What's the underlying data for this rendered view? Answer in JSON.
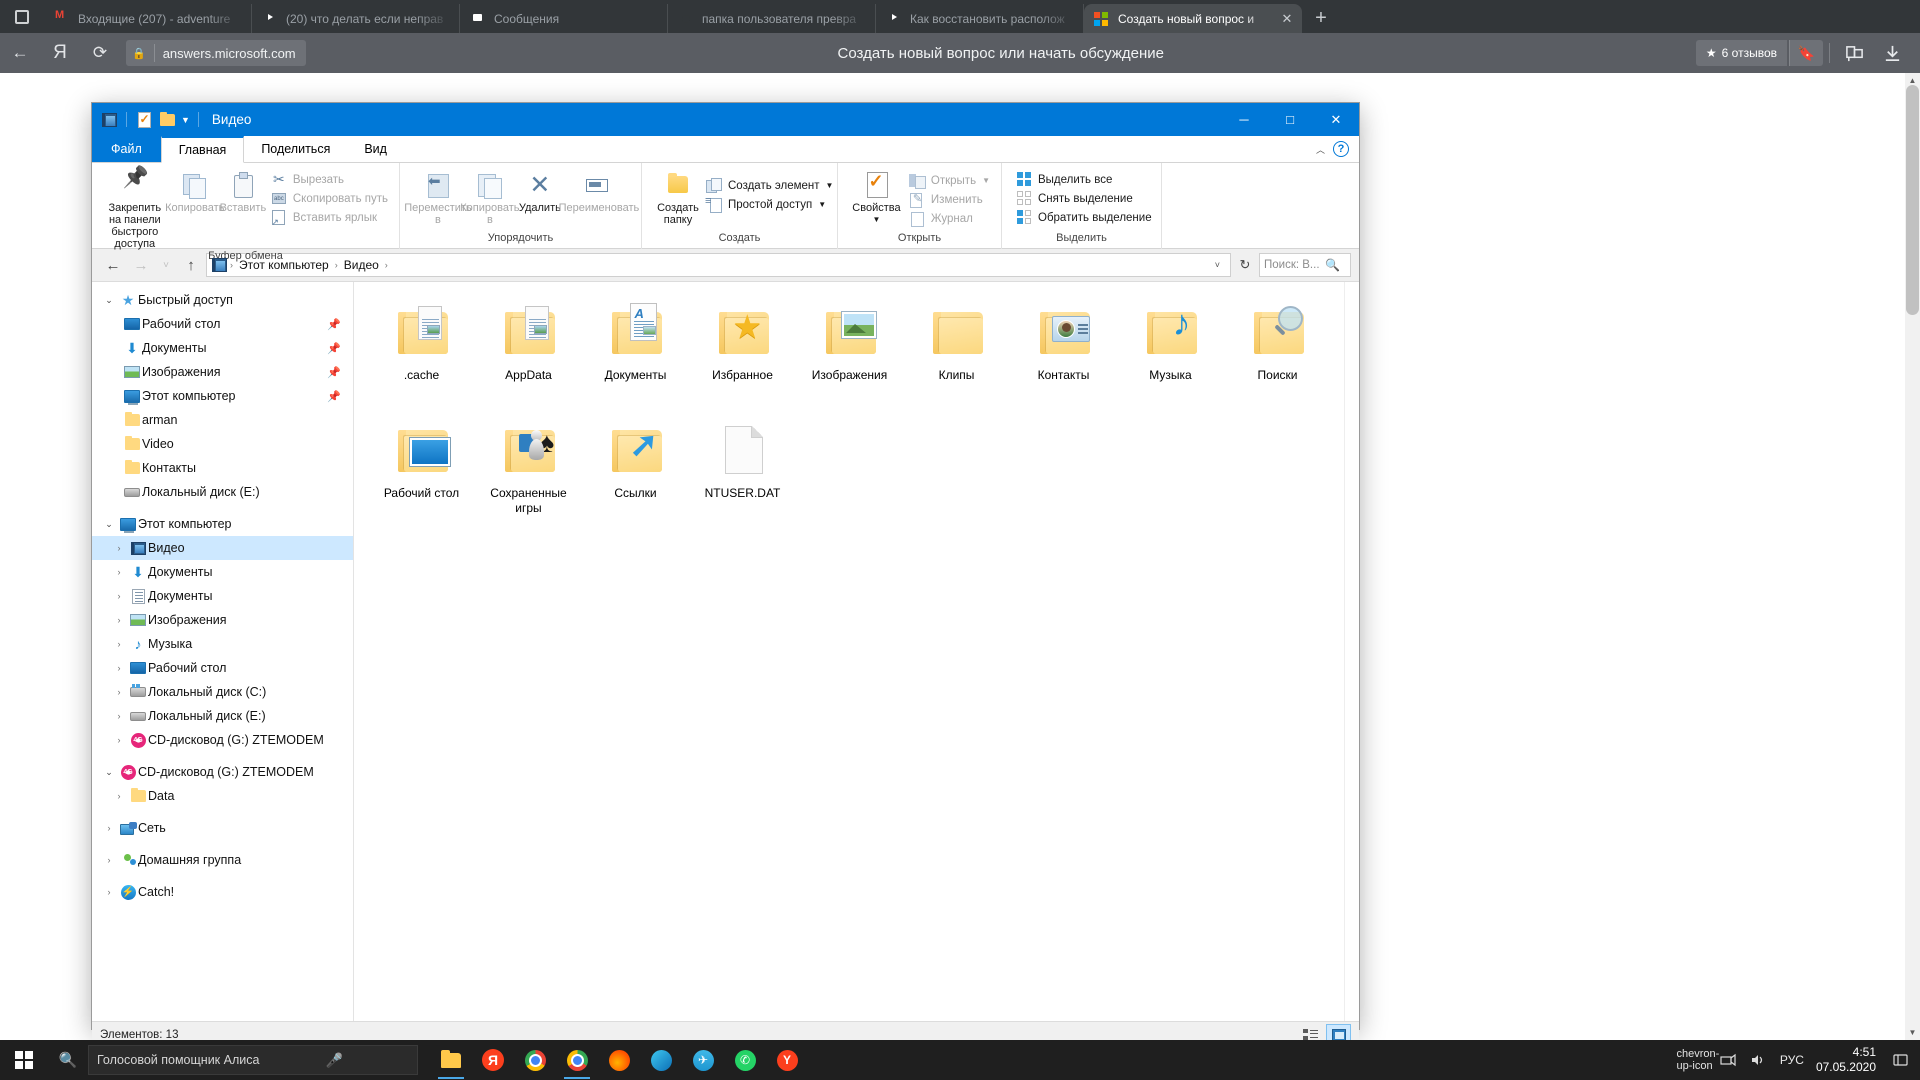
{
  "browser": {
    "tabs": [
      {
        "title": "Входящие (207) - adventure",
        "favicon": "gmail-icon",
        "active": false
      },
      {
        "title": "(20) что делать если неправ",
        "favicon": "youtube-icon",
        "active": false
      },
      {
        "title": "Сообщения",
        "favicon": "messages-icon",
        "active": false
      },
      {
        "title": "папка пользователя превра",
        "favicon": "google-icon",
        "active": false
      },
      {
        "title": "Как восстановить располож",
        "favicon": "youtube-icon",
        "active": false
      },
      {
        "title": "Создать новый вопрос и",
        "favicon": "microsoft-icon",
        "active": true
      }
    ],
    "new_tab_label": "+",
    "tab_close_label": "✕",
    "back_label": "←",
    "brand_label": "Я",
    "reload_label": "⟳",
    "url": "answers.microsoft.com",
    "lock_icon": "lock-icon",
    "page_title": "Создать новый вопрос или начать обсуждение",
    "reviews_label": "6 отзывов",
    "reviews_star": "★",
    "bookmark_icon": "bookmark-icon",
    "collections_icon": "collections-icon",
    "download_icon": "download-icon"
  },
  "explorer": {
    "title": "Видео",
    "quick_access_icons": [
      "video-library-icon",
      "properties-icon",
      "new-folder-icon",
      "dropdown-caret-icon"
    ],
    "window_controls": {
      "minimize": "─",
      "maximize": "□",
      "close": "✕"
    },
    "ribbon_tabs": [
      {
        "label": "Файл",
        "type": "file"
      },
      {
        "label": "Главная",
        "type": "selected"
      },
      {
        "label": "Поделиться",
        "type": "normal"
      },
      {
        "label": "Вид",
        "type": "normal"
      }
    ],
    "ribbon_collapse_icon": "chevron-up-icon",
    "help_icon": "?",
    "ribbon_groups": [
      {
        "label": "Буфер обмена",
        "big_buttons": [
          {
            "label": "Закрепить на панели быстрого доступа",
            "icon": "pin-icon",
            "dim": false
          },
          {
            "label": "Копировать",
            "icon": "copy-icon",
            "dim": true
          },
          {
            "label": "Вставить",
            "icon": "paste-icon",
            "dim": true
          }
        ],
        "small_buttons": [
          {
            "label": "Вырезать",
            "icon": "scissors-icon",
            "dim": true
          },
          {
            "label": "Скопировать путь",
            "icon": "copy-path-icon",
            "dim": true
          },
          {
            "label": "Вставить ярлык",
            "icon": "paste-shortcut-icon",
            "dim": true
          }
        ]
      },
      {
        "label": "Упорядочить",
        "big_buttons": [
          {
            "label": "Переместить в",
            "icon": "move-to-icon",
            "dim": true,
            "caret": true
          },
          {
            "label": "Копировать в",
            "icon": "copy-to-icon",
            "dim": true,
            "caret": true
          },
          {
            "label": "Удалить",
            "icon": "delete-icon",
            "dim": false,
            "caret": false
          },
          {
            "label": "Переименовать",
            "icon": "rename-icon",
            "dim": true,
            "caret": false
          }
        ],
        "small_buttons": []
      },
      {
        "label": "Создать",
        "big_buttons": [
          {
            "label": "Создать папку",
            "icon": "new-folder-icon",
            "dim": false
          }
        ],
        "small_buttons": [
          {
            "label": "Создать элемент",
            "icon": "new-item-icon",
            "dim": false,
            "caret": true
          },
          {
            "label": "Простой доступ",
            "icon": "easy-access-icon",
            "dim": false,
            "caret": true
          }
        ]
      },
      {
        "label": "Открыть",
        "big_buttons": [
          {
            "label": "Свойства",
            "icon": "properties-icon",
            "dim": false,
            "caret": true
          }
        ],
        "small_buttons": [
          {
            "label": "Открыть",
            "icon": "open-icon",
            "dim": true,
            "caret": true
          },
          {
            "label": "Изменить",
            "icon": "edit-icon",
            "dim": true,
            "caret": false
          },
          {
            "label": "Журнал",
            "icon": "history-icon",
            "dim": true,
            "caret": false
          }
        ]
      },
      {
        "label": "Выделить",
        "big_buttons": [],
        "small_buttons": [
          {
            "label": "Выделить все",
            "icon": "select-all-icon",
            "dim": false,
            "caret": false
          },
          {
            "label": "Снять выделение",
            "icon": "select-none-icon",
            "dim": false,
            "caret": false
          },
          {
            "label": "Обратить выделение",
            "icon": "invert-selection-icon",
            "dim": false,
            "caret": false
          }
        ]
      }
    ],
    "nav": {
      "back": "←",
      "forward": "→",
      "recent": "˅",
      "up": "↑",
      "refresh": "↻",
      "breadcrumb_icon": "video-library-icon",
      "breadcrumbs": [
        "Этот компьютер",
        "Видео"
      ],
      "separator": "›",
      "dropdown_caret": "˅",
      "search_placeholder": "Поиск: В...",
      "search_icon": "search-icon"
    },
    "tree": [
      {
        "label": "Быстрый доступ",
        "icon": "quick-access-star-icon",
        "indent": 0,
        "chevron": "open",
        "pinned": false
      },
      {
        "label": "Рабочий стол",
        "icon": "desktop-icon",
        "indent": 1,
        "chevron": "none",
        "pinned": true
      },
      {
        "label": "Документы",
        "icon": "downloads-icon",
        "indent": 1,
        "chevron": "none",
        "pinned": true
      },
      {
        "label": "Изображения",
        "icon": "pictures-icon",
        "indent": 1,
        "chevron": "none",
        "pinned": true
      },
      {
        "label": "Этот компьютер",
        "icon": "this-pc-icon",
        "indent": 1,
        "chevron": "none",
        "pinned": true
      },
      {
        "label": "arman",
        "icon": "folder-icon",
        "indent": 1,
        "chevron": "none",
        "pinned": false
      },
      {
        "label": "Video",
        "icon": "folder-icon",
        "indent": 1,
        "chevron": "none",
        "pinned": false
      },
      {
        "label": "Контакты",
        "icon": "folder-icon",
        "indent": 1,
        "chevron": "none",
        "pinned": false
      },
      {
        "label": "Локальный диск (E:)",
        "icon": "disk-icon",
        "indent": 1,
        "chevron": "none",
        "pinned": false
      },
      {
        "label": "Этот компьютер",
        "icon": "this-pc-icon",
        "indent": 0,
        "chevron": "open",
        "pinned": false
      },
      {
        "label": "Видео",
        "icon": "video-library-icon",
        "indent": 1,
        "chevron": "closed",
        "pinned": false,
        "selected": true
      },
      {
        "label": "Документы",
        "icon": "downloads-icon",
        "indent": 1,
        "chevron": "closed",
        "pinned": false
      },
      {
        "label": "Документы",
        "icon": "documents-icon",
        "indent": 1,
        "chevron": "closed",
        "pinned": false
      },
      {
        "label": "Изображения",
        "icon": "pictures-icon",
        "indent": 1,
        "chevron": "closed",
        "pinned": false
      },
      {
        "label": "Музыка",
        "icon": "music-icon",
        "indent": 1,
        "chevron": "closed",
        "pinned": false
      },
      {
        "label": "Рабочий стол",
        "icon": "desktop-icon",
        "indent": 1,
        "chevron": "closed",
        "pinned": false
      },
      {
        "label": "Локальный диск (C:)",
        "icon": "system-disk-icon",
        "indent": 1,
        "chevron": "closed",
        "pinned": false
      },
      {
        "label": "Локальный диск (E:)",
        "icon": "disk-icon",
        "indent": 1,
        "chevron": "closed",
        "pinned": false
      },
      {
        "label": "CD-дисковод (G:) ZTEMODEM",
        "icon": "cd-drive-icon",
        "indent": 1,
        "chevron": "closed",
        "pinned": false
      },
      {
        "label": "CD-дисковод (G:) ZTEMODEM",
        "icon": "cd-drive-icon",
        "indent": 0,
        "chevron": "open",
        "pinned": false
      },
      {
        "label": "Data",
        "icon": "folder-icon",
        "indent": 1,
        "chevron": "closed",
        "pinned": false
      },
      {
        "label": "Сеть",
        "icon": "network-icon",
        "indent": 0,
        "chevron": "closed",
        "pinned": false
      },
      {
        "label": "Домашняя группа",
        "icon": "homegroup-icon",
        "indent": 0,
        "chevron": "closed",
        "pinned": false
      },
      {
        "label": "Catch!",
        "icon": "catch-icon",
        "indent": 0,
        "chevron": "closed",
        "pinned": false
      }
    ],
    "files": [
      {
        "name": ".cache",
        "icon": "folder-with-papers-icon"
      },
      {
        "name": "AppData",
        "icon": "folder-with-papers-icon"
      },
      {
        "name": "Документы",
        "icon": "documents-folder-icon"
      },
      {
        "name": "Избранное",
        "icon": "favorites-folder-icon"
      },
      {
        "name": "Изображения",
        "icon": "pictures-folder-icon"
      },
      {
        "name": "Клипы",
        "icon": "plain-folder-icon"
      },
      {
        "name": "Контакты",
        "icon": "contacts-folder-icon"
      },
      {
        "name": "Музыка",
        "icon": "music-folder-icon"
      },
      {
        "name": "Поиски",
        "icon": "searches-folder-icon"
      },
      {
        "name": "Рабочий стол",
        "icon": "desktop-folder-icon"
      },
      {
        "name": "Сохраненные игры",
        "icon": "saved-games-folder-icon"
      },
      {
        "name": "Ссылки",
        "icon": "links-folder-icon"
      },
      {
        "name": "NTUSER.DAT",
        "icon": "generic-file-icon"
      }
    ],
    "status": {
      "items_count": "Элементов: 13",
      "view_details_icon": "details-view-icon",
      "view_tiles_icon": "tiles-view-icon"
    }
  },
  "taskbar": {
    "start_icon": "windows-start-icon",
    "search_icon": "search-icon",
    "search_value": "Голосовой помощник Алиса",
    "mic_icon": "microphone-icon",
    "apps": [
      {
        "icon": "file-explorer-icon",
        "active": true
      },
      {
        "icon": "yandex-browser-icon",
        "active": false
      },
      {
        "icon": "chrome-icon",
        "active": false
      },
      {
        "icon": "chrome-icon",
        "active": true
      },
      {
        "icon": "firefox-icon",
        "active": false
      },
      {
        "icon": "edge-icon",
        "active": false
      },
      {
        "icon": "telegram-icon",
        "active": false
      },
      {
        "icon": "whatsapp-icon",
        "active": false
      },
      {
        "icon": "yandex-icon",
        "active": false
      }
    ],
    "tray": {
      "expand_icon": "chevron-up-icon",
      "network_icon": "network-icon",
      "volume_icon": "volume-icon",
      "language": "РУС",
      "time": "4:51",
      "date": "07.05.2020",
      "notifications_icon": "notification-icon"
    }
  }
}
